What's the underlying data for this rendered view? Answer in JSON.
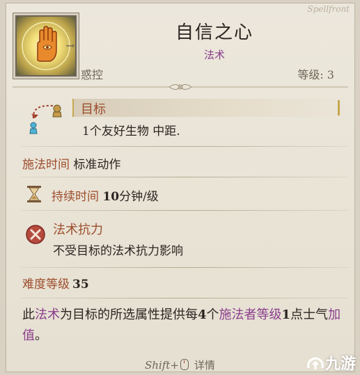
{
  "spell": {
    "name": "自信之心",
    "type": "法术",
    "school": "惑控",
    "level_label": "等级: 3",
    "signature": "Spellfront"
  },
  "target": {
    "label": "目标",
    "description": "1个友好生物 中距."
  },
  "casting_time": {
    "label": "施法时间",
    "value": "标准动作"
  },
  "duration": {
    "label": "持续时间",
    "value_num": "10",
    "value_unit": "分钟/级"
  },
  "spell_resistance": {
    "label": "法术抗力",
    "value": "不受目标的法术抗力影响"
  },
  "dc": {
    "label": "难度等级",
    "value": "35"
  },
  "description": {
    "p1": "此",
    "k1": "法术",
    "p2": "为目标的所选属性提供每",
    "n1": "4",
    "p3": "个",
    "k2": "施法者等级",
    "n2": "1",
    "p4": "点士气",
    "k3": "加值",
    "p5": "。"
  },
  "footer": {
    "shift_label": "Shift+",
    "detail_label": "详情"
  },
  "watermark": {
    "text": "九游"
  },
  "colors": {
    "accent_brown": "#9c4d2c",
    "accent_purple": "#8a3d8c",
    "gold": "#c7a74e"
  }
}
